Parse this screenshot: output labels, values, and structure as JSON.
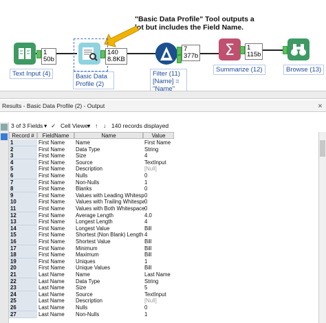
{
  "annotation": "\"Basic Data Profile\" Tool outputs a lot but includes the Field Name.",
  "tools": [
    {
      "label": "Text Input (4)",
      "badge": [
        "1",
        "50b"
      ]
    },
    {
      "label": "Basic Data Profile (2)",
      "badge": [
        "140",
        "8.8KB"
      ]
    },
    {
      "label": "Filter (11) [Name] = \"Name\"",
      "badge": [
        "7",
        "377b"
      ]
    },
    {
      "label": "Summarize (12)",
      "badge": [
        "1",
        "115b"
      ]
    },
    {
      "label": "Browse (13)"
    }
  ],
  "results": {
    "title": "Results - Basic Data Profile (2) - Output",
    "fields_selector": "3 of 3 Fields",
    "cell_viewer": "Cell Viewer",
    "records_displayed": "140 records displayed",
    "columns": [
      "Record #",
      "FieldName",
      "Name",
      "Value"
    ],
    "rows": [
      [
        "1",
        "First Name",
        "Name",
        "First Name"
      ],
      [
        "2",
        "First Name",
        "Data Type",
        "String"
      ],
      [
        "3",
        "First Name",
        "Size",
        "4"
      ],
      [
        "4",
        "First Name",
        "Source",
        "TextInput"
      ],
      [
        "5",
        "First Name",
        "Description",
        "[Null]"
      ],
      [
        "6",
        "First Name",
        "Nulls",
        "0"
      ],
      [
        "7",
        "First Name",
        "Non-Nulls",
        "1"
      ],
      [
        "8",
        "First Name",
        "Blanks",
        "0"
      ],
      [
        "9",
        "First Name",
        "Values with Leading Whitespace",
        "0"
      ],
      [
        "10",
        "First Name",
        "Values with Trailing Whitespace",
        "0"
      ],
      [
        "11",
        "First Name",
        "Values with Both Whitespace",
        "0"
      ],
      [
        "12",
        "First Name",
        "Average Length",
        "4.0"
      ],
      [
        "13",
        "First Name",
        "Longest Length",
        "4"
      ],
      [
        "14",
        "First Name",
        "Longest Value",
        "Bill"
      ],
      [
        "15",
        "First Name",
        "Shortest (Non Blank) Length",
        "4"
      ],
      [
        "16",
        "First Name",
        "Shortest Value",
        "Bill"
      ],
      [
        "17",
        "First Name",
        "Minimum",
        "Bill"
      ],
      [
        "18",
        "First Name",
        "Maximum",
        "Bill"
      ],
      [
        "19",
        "First Name",
        "Uniques",
        "1"
      ],
      [
        "20",
        "First Name",
        "Unique Values",
        "Bill"
      ],
      [
        "21",
        "Last Name",
        "Name",
        "Last Name"
      ],
      [
        "22",
        "Last Name",
        "Data Type",
        "String"
      ],
      [
        "23",
        "Last Name",
        "Size",
        "5"
      ],
      [
        "24",
        "Last Name",
        "Source",
        "TextInput"
      ],
      [
        "25",
        "Last Name",
        "Description",
        "[Null]"
      ],
      [
        "26",
        "Last Name",
        "Nulls",
        "0"
      ],
      [
        "27",
        "Last Name",
        "Non-Nulls",
        "1"
      ]
    ]
  },
  "colors": {
    "accent": "#3a7bd5",
    "arrow": "#f0b400"
  }
}
